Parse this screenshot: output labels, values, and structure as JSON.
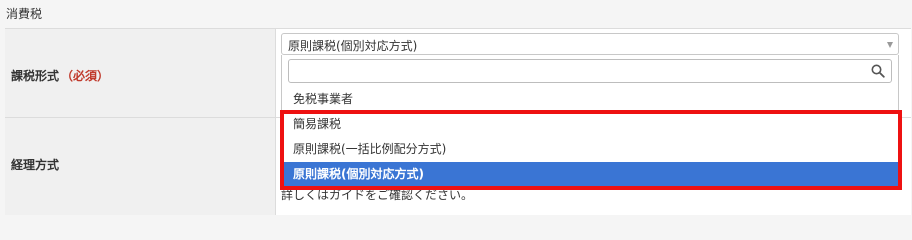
{
  "section": {
    "title": "消費税"
  },
  "fields": {
    "tax_method": {
      "label": "課税形式",
      "required": "（必須）"
    },
    "accounting": {
      "label": "経理方式"
    }
  },
  "select": {
    "value": "原則課税(個別対応方式)"
  },
  "dropdown": {
    "search_placeholder": "",
    "options": [
      {
        "label": "免税事業者"
      },
      {
        "label": "簡易課税"
      },
      {
        "label": "原則課税(一括比例配分方式)"
      },
      {
        "label": "原則課税(個別対応方式)"
      }
    ]
  },
  "help": {
    "text": "詳しくはガイドをご確認ください。"
  },
  "colors": {
    "selected": "#3a75d4",
    "highlight": "#ee1111",
    "required": "#c0392b"
  }
}
